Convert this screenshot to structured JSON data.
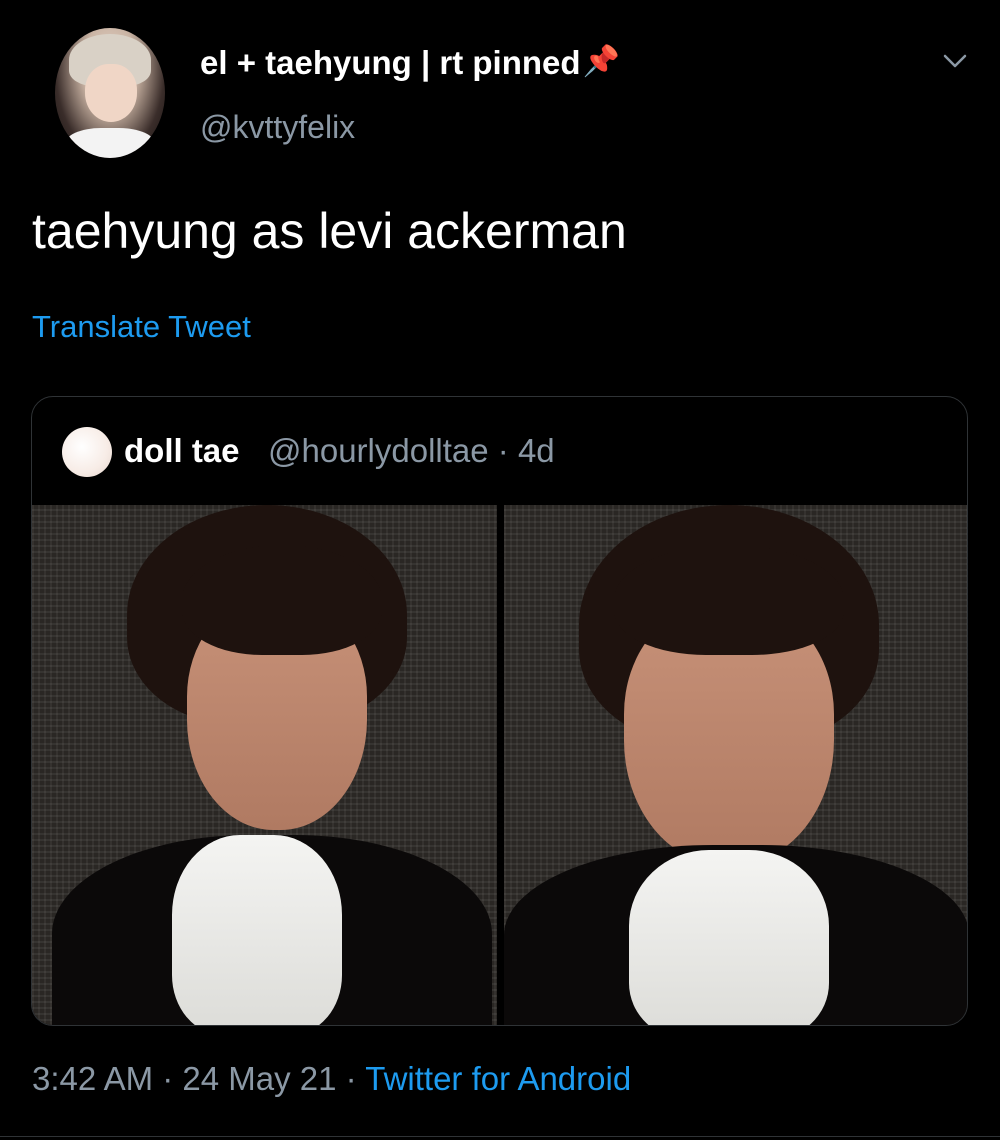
{
  "tweet": {
    "author": {
      "display_name": "el + taehyung | rt pinned",
      "pin_icon": "📌",
      "handle": "@kvttyfelix"
    },
    "text": "taehyung as levi ackerman",
    "translate_label": "Translate Tweet",
    "quoted": {
      "name": "doll tae",
      "meta": "@hourlydolltae · 4d",
      "photos": [
        "photo-left",
        "photo-right"
      ]
    },
    "footer": {
      "time_date": "3:42 AM · 24 May 21 · ",
      "source": "Twitter for Android"
    }
  },
  "colors": {
    "background": "#000000",
    "link": "#1d9bf0",
    "muted": "#8b98a5",
    "border": "#2f3336",
    "pin": "#e0245e"
  },
  "icons": {
    "more": "chevron-down-icon",
    "pin": "pushpin-icon"
  }
}
